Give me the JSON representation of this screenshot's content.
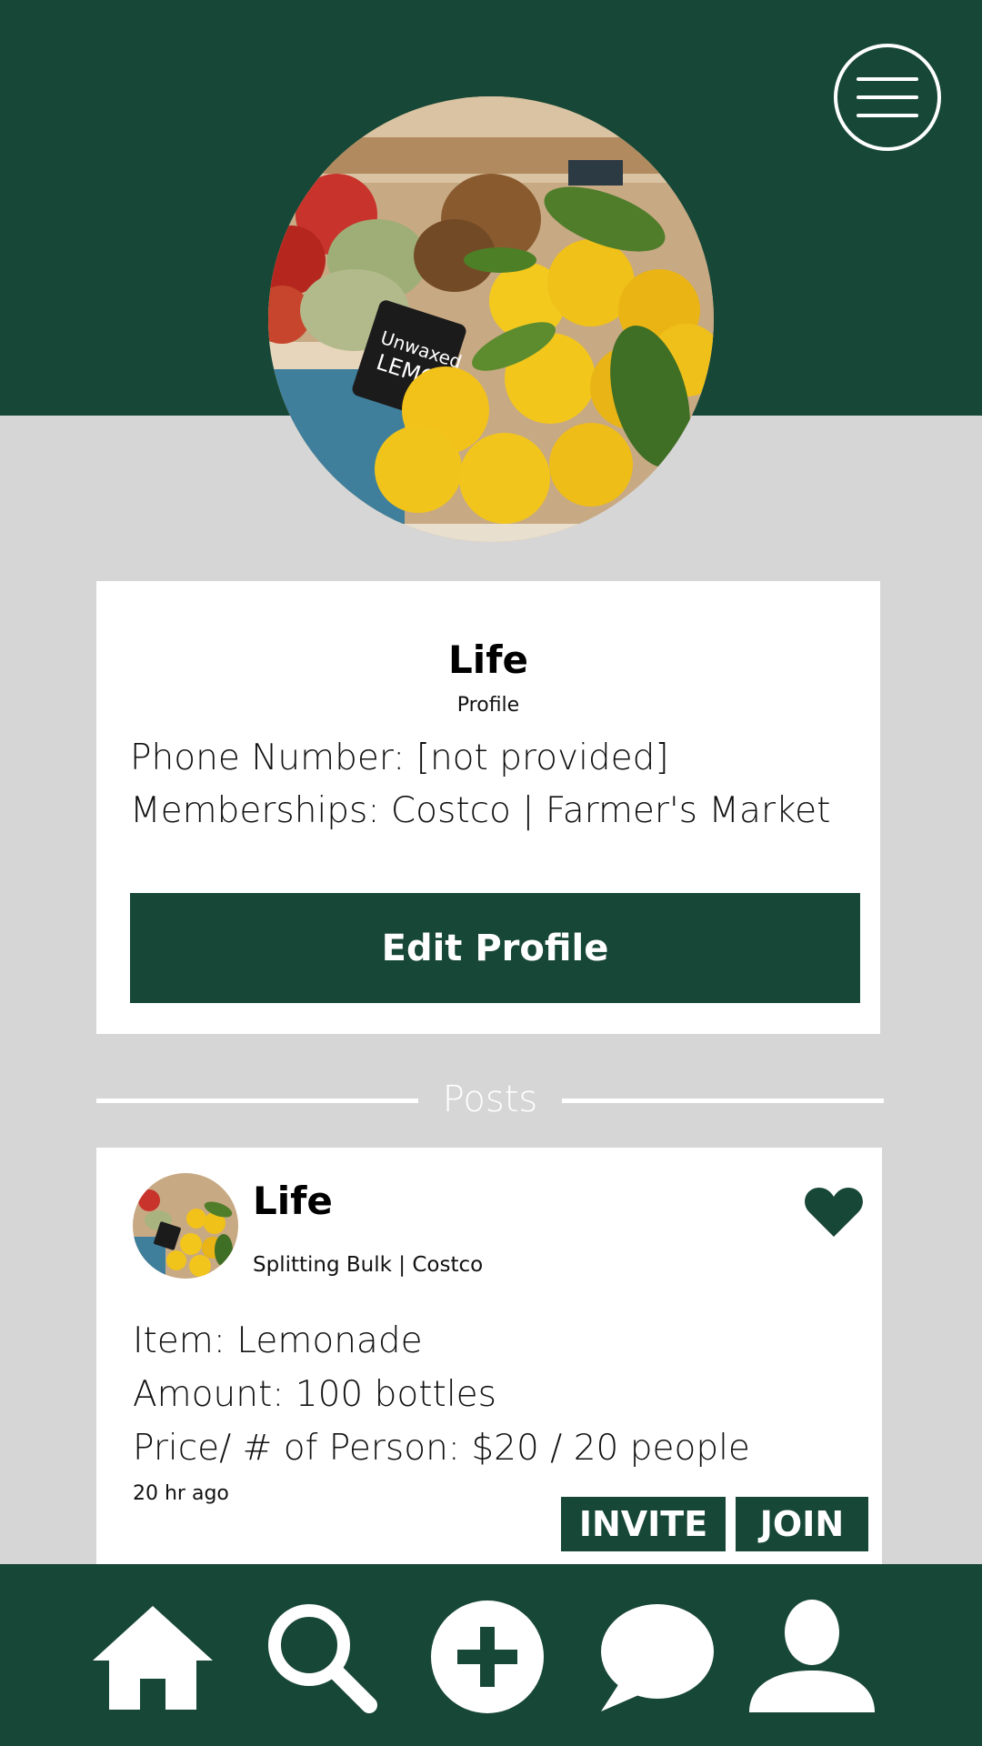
{
  "profile": {
    "name": "Life",
    "subtitle": "Profile",
    "phone_line": "Phone Number: [not provided]",
    "memberships_line": "Memberships: Costco | Farmer's Market",
    "edit_button_label": "Edit Profile"
  },
  "posts_section": {
    "title": "Posts"
  },
  "post": {
    "author": "Life",
    "group": "Splitting Bulk | Costco",
    "item_line": "Item: Lemonade",
    "amount_line": "Amount: 100 bottles",
    "price_line": "Price/ # of Person: $20 / 20 people",
    "time": "20 hr ago",
    "invite_label": "INVITE",
    "join_label": "JOIN"
  },
  "nav": {
    "items": [
      {
        "name": "home-icon"
      },
      {
        "name": "search-icon"
      },
      {
        "name": "add-icon"
      },
      {
        "name": "chat-icon"
      },
      {
        "name": "profile-icon"
      }
    ]
  },
  "colors": {
    "brand_green": "#174736",
    "background": "#d6d6d6",
    "card": "#ffffff"
  }
}
